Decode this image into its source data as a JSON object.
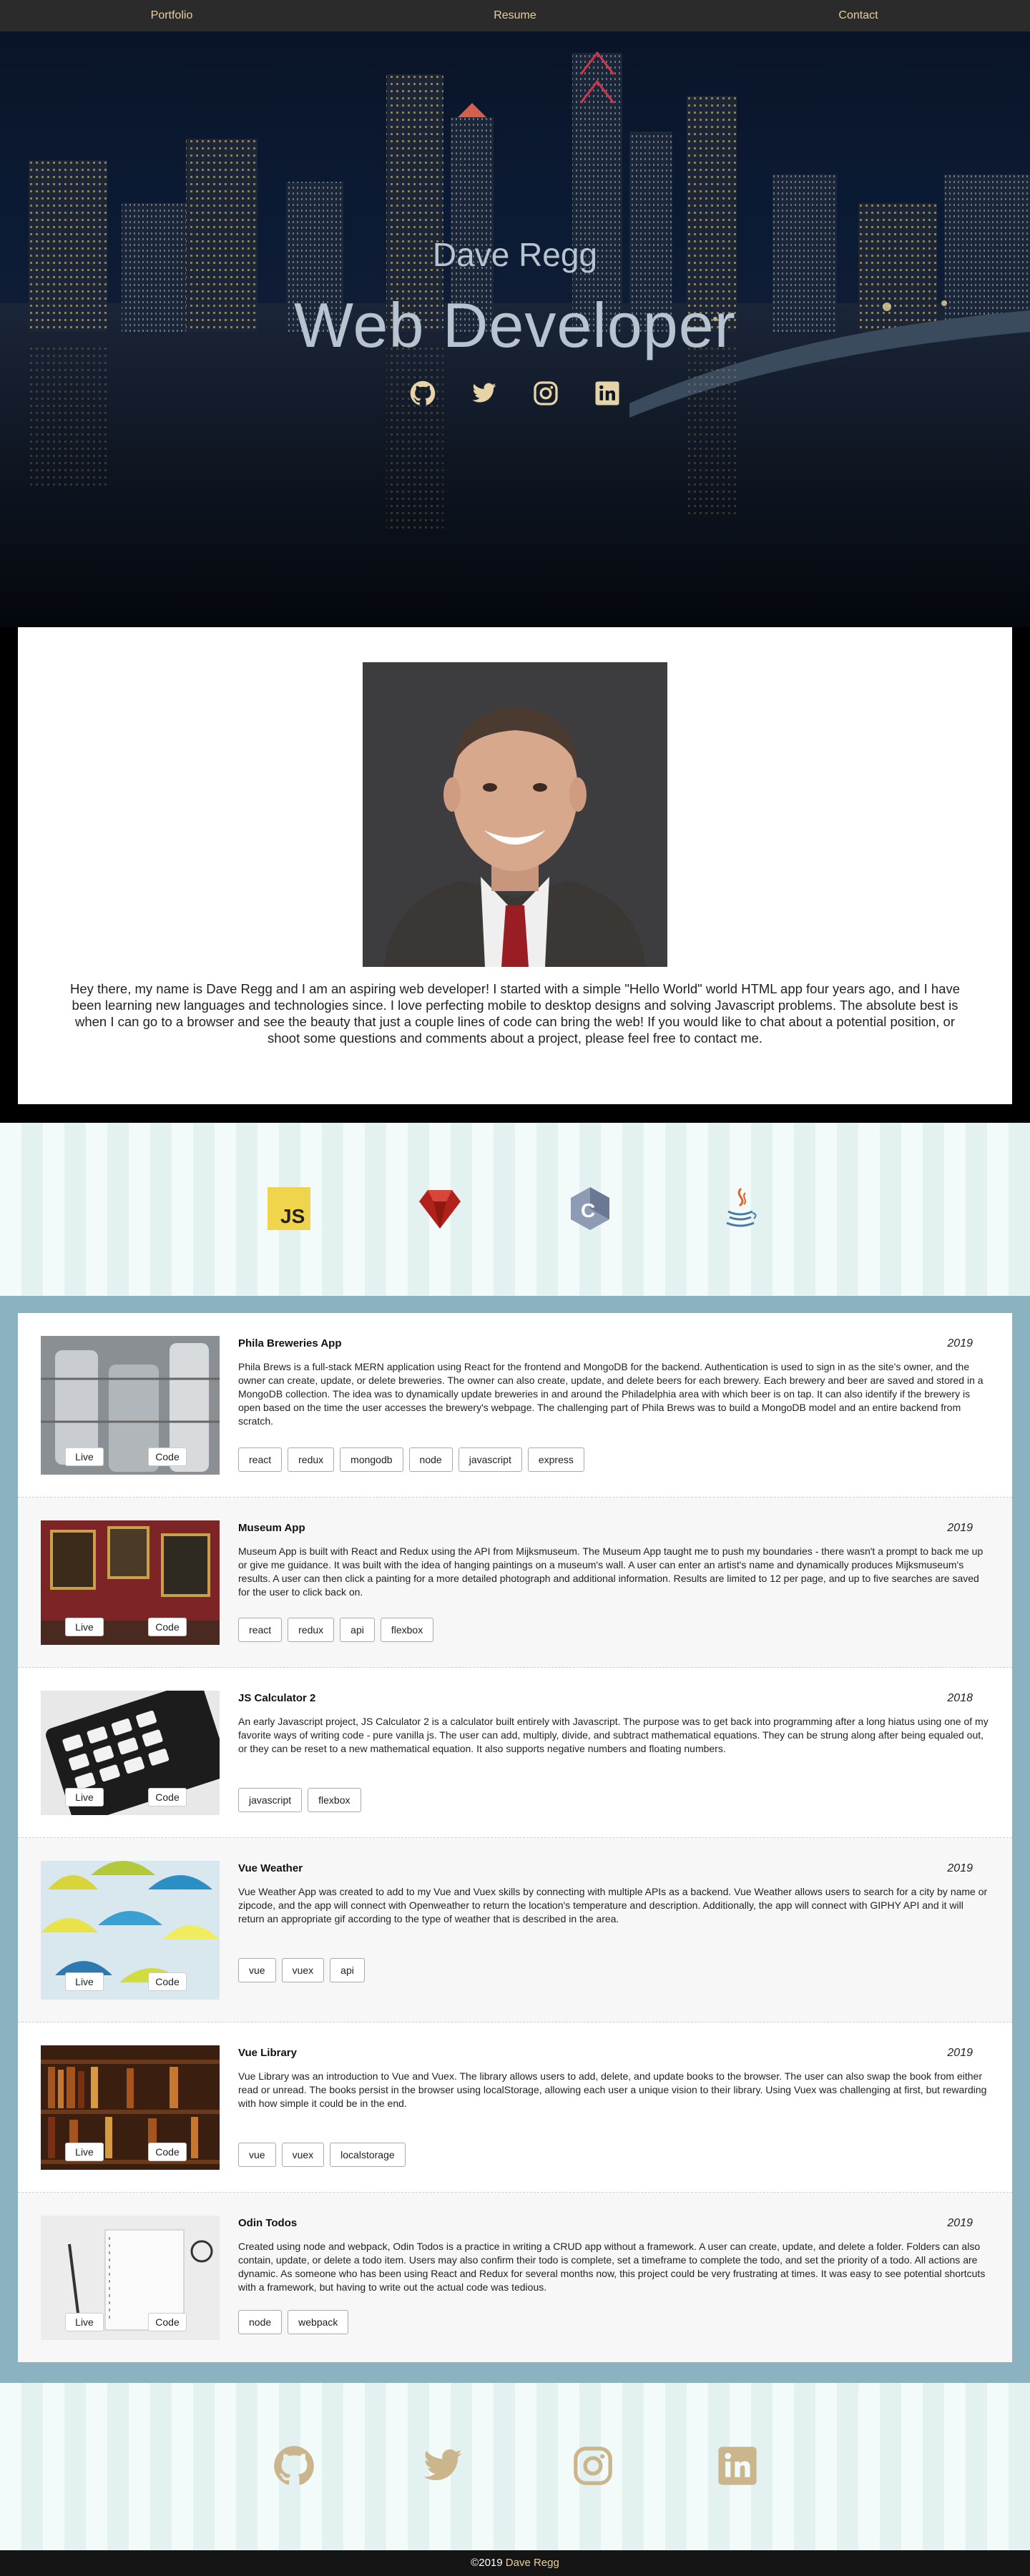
{
  "nav": {
    "items": [
      "Portfolio",
      "Resume",
      "Contact"
    ]
  },
  "hero": {
    "name": "Dave Regg",
    "title": "Web Developer",
    "icons": [
      "github-icon",
      "twitter-icon",
      "instagram-icon",
      "linkedin-icon"
    ]
  },
  "about": {
    "text": "Hey there, my name is Dave Regg and I am an aspiring web developer! I started with a simple \"Hello World\" world HTML app four years ago, and I have been learning new languages and technologies since. I love perfecting mobile to desktop designs and solving Javascript problems. The absolute best is when I can go to a browser and see the beauty that just a couple lines of code can bring the web! If you would like to chat about a potential position, or shoot some questions and comments about a project, please feel free to contact me."
  },
  "skills": [
    "javascript-icon",
    "ruby-icon",
    "c-icon",
    "java-icon"
  ],
  "projects": [
    {
      "title": "Phila Breweries App",
      "year": "2019",
      "desc": "Phila Brews is a full-stack MERN application using React for the frontend and MongoDB for the backend. Authentication is used to sign in as the site's owner, and the owner can create, update, or delete breweries. The owner can also create, update, and delete beers for each brewery. Each brewery and beer are saved and stored in a MongoDB collection. The idea was to dynamically update breweries in and around the Philadelphia area with which beer is on tap. It can also identify if the brewery is open based on the time the user accesses the brewery's webpage. The challenging part of Phila Brews was to build a MongoDB model and an entire backend from scratch.",
      "tags": [
        "react",
        "redux",
        "mongodb",
        "node",
        "javascript",
        "express"
      ],
      "live": "Live",
      "code": "Code"
    },
    {
      "title": "Museum App",
      "year": "2019",
      "desc": "Museum App is built with React and Redux using the API from Mijksmuseum. The Museum App taught me to push my boundaries - there wasn't a prompt to back me up or give me guidance. It was built with the idea of hanging paintings on a museum's wall. A user can enter an artist's name and dynamically produces Mijksmuseum's results. A user can then click a painting for a more detailed photograph and additional information. Results are limited to 12 per page, and up to five searches are saved for the user to click back on.",
      "tags": [
        "react",
        "redux",
        "api",
        "flexbox"
      ],
      "live": "Live",
      "code": "Code"
    },
    {
      "title": "JS Calculator 2",
      "year": "2018",
      "desc": "An early Javascript project, JS Calculator 2 is a calculator built entirely with Javascript. The purpose was to get back into programming after a long hiatus using one of my favorite ways of writing code - pure vanilla js. The user can add, multiply, divide, and subtract mathematical equations. They can be strung along after being equaled out, or they can be reset to a new mathematical equation. It also supports negative numbers and floating numbers.",
      "tags": [
        "javascript",
        "flexbox"
      ],
      "live": "Live",
      "code": "Code"
    },
    {
      "title": "Vue Weather",
      "year": "2019",
      "desc": "Vue Weather App was created to add to my Vue and Vuex skills by connecting with multiple APIs as a backend. Vue Weather allows users to search for a city by name or zipcode, and the app will connect with Openweather to return the location's temperature and description. Additionally, the app will connect with GIPHY API and it will return an appropriate gif according to the type of weather that is described in the area.",
      "tags": [
        "vue",
        "vuex",
        "api"
      ],
      "live": "Live",
      "code": "Code"
    },
    {
      "title": "Vue Library",
      "year": "2019",
      "desc": "Vue Library was an introduction to Vue and Vuex. The library allows users to add, delete, and update books to the browser. The user can also swap the book from either read or unread. The books persist in the browser using localStorage, allowing each user a unique vision to their library. Using Vuex was challenging at first, but rewarding with how simple it could be in the end.",
      "tags": [
        "vue",
        "vuex",
        "localstorage"
      ],
      "live": "Live",
      "code": "Code"
    },
    {
      "title": "Odin Todos",
      "year": "2019",
      "desc": "Created using node and webpack, Odin Todos is a practice in writing a CRUD app without a framework. A user can create, update, and delete a folder. Folders can also contain, update, or delete a todo item. Users may also confirm their todo is complete, set a timeframe to complete the todo, and set the priority of a todo. All actions are dynamic. As someone who has been using React and Redux for several months now, this project could be very frustrating at times. It was easy to see potential shortcuts with a framework, but having to write out the actual code was tedious.",
      "tags": [
        "node",
        "webpack"
      ],
      "live": "Live",
      "code": "Code"
    }
  ],
  "social": [
    "github-icon",
    "twitter-icon",
    "instagram-icon",
    "linkedin-icon"
  ],
  "footer": {
    "copy": "©2019",
    "name": "Dave Regg"
  },
  "colors": {
    "accent": "#e8cf9a",
    "projects_bg": "#8ab2c1",
    "icon_tan": "#cbb58d"
  }
}
